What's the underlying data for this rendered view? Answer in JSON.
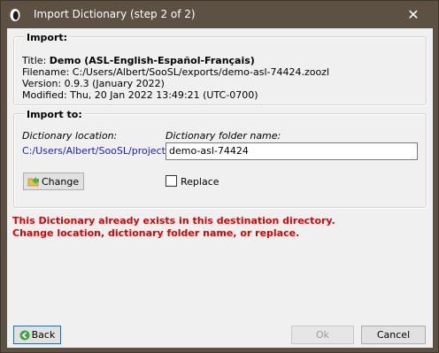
{
  "window": {
    "title": "Import Dictionary (step 2 of 2)",
    "close_glyph": "✕"
  },
  "import_group": {
    "title": "Import:",
    "title_label": "Title: ",
    "title_value": "Demo (ASL-English-Español-Français)",
    "filename": "Filename: C:/Users/Albert/SooSL/exports/demo-asl-74424.zoozl",
    "version": "Version: 0.9.3 (January 2022)",
    "modified": "Modified: Thu, 20 Jan 2022 13:49:21 (UTC-0700)"
  },
  "import_to_group": {
    "title": "Import to:",
    "location_label": "Dictionary location:",
    "location_value": "C:/Users/Albert/SooSL/projects/",
    "folder_label": "Dictionary folder name:",
    "folder_value": "demo-asl-74424",
    "change_label": "Change",
    "replace_label": "Replace",
    "replace_checked": false
  },
  "error": {
    "line1": "This Dictionary already exists in this destination directory.",
    "line2": "Change location, dictionary folder name, or replace."
  },
  "footer": {
    "back_label": "Back",
    "ok_label": "Ok",
    "cancel_label": "Cancel"
  },
  "icons": {
    "app": "soosl-app-icon",
    "change": "folder-arrow-icon",
    "back": "back-arrow-icon"
  }
}
